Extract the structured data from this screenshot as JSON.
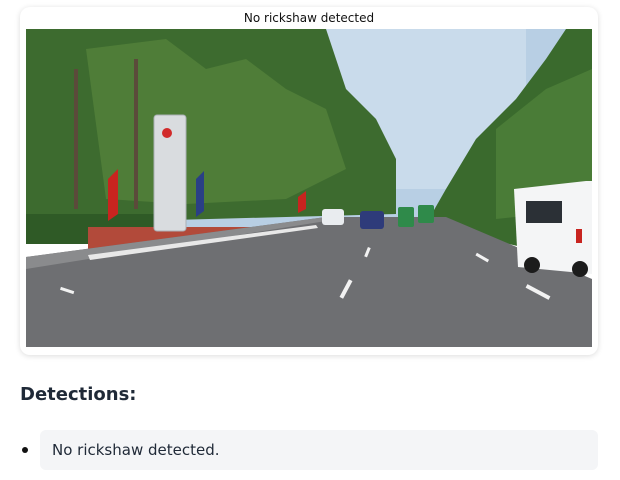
{
  "result": {
    "caption": "No rickshaw detected",
    "image_alt": "Road scene with palm trees, a signboard pillar and vehicles"
  },
  "detections": {
    "heading": "Detections:",
    "items": [
      {
        "text": "No rickshaw detected."
      }
    ]
  }
}
